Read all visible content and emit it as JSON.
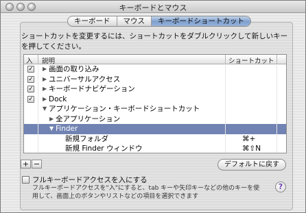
{
  "window": {
    "title": "キーボードとマウス"
  },
  "tabs": [
    {
      "label": "キーボード",
      "active": false
    },
    {
      "label": "マウス",
      "active": false
    },
    {
      "label": "キーボードショートカット",
      "active": true
    }
  ],
  "instruction": "ショートカットを変更するには、ショートカットをダブルクリックして新しいキーを押してください。",
  "table": {
    "headers": {
      "enabled": "入",
      "description": "説明",
      "shortcut": "ショートカット"
    },
    "rows": [
      {
        "checked": true,
        "expander": "▶",
        "label": "画面の取り込み",
        "shortcut": ""
      },
      {
        "checked": true,
        "expander": "▶",
        "label": "ユニバーサルアクセス",
        "shortcut": ""
      },
      {
        "checked": true,
        "expander": "▶",
        "label": "キーボードナビゲーション",
        "shortcut": ""
      },
      {
        "checked": true,
        "expander": "▶",
        "label": "Dock",
        "shortcut": ""
      },
      {
        "checked": false,
        "expander": "▼",
        "label": "アプリケーション・キーボードショートカット",
        "shortcut": ""
      },
      {
        "checked": false,
        "expander": "▶",
        "label": "全アプリケーション",
        "shortcut": ""
      },
      {
        "checked": false,
        "expander": "▼",
        "label": "Finder",
        "shortcut": "",
        "selected": true
      },
      {
        "checked": false,
        "expander": "",
        "label": "新規フォルダ",
        "shortcut": "⌘+"
      },
      {
        "checked": false,
        "expander": "",
        "label": "新規 Finder ウィンドウ",
        "shortcut": "⌘⇧N"
      }
    ]
  },
  "buttons": {
    "add": "+",
    "remove": "−",
    "restore_defaults": "デフォルトに戻す"
  },
  "full_keyboard_access": {
    "label": "フルキーボードアクセスを入にする",
    "note": "フルキーボードアクセスを\"入\"にすると、tab キーや矢印キーなどの他のキーを使用して、画面上のボタンやリストなどの項目を選択できます",
    "checked": false
  },
  "help": "?"
}
